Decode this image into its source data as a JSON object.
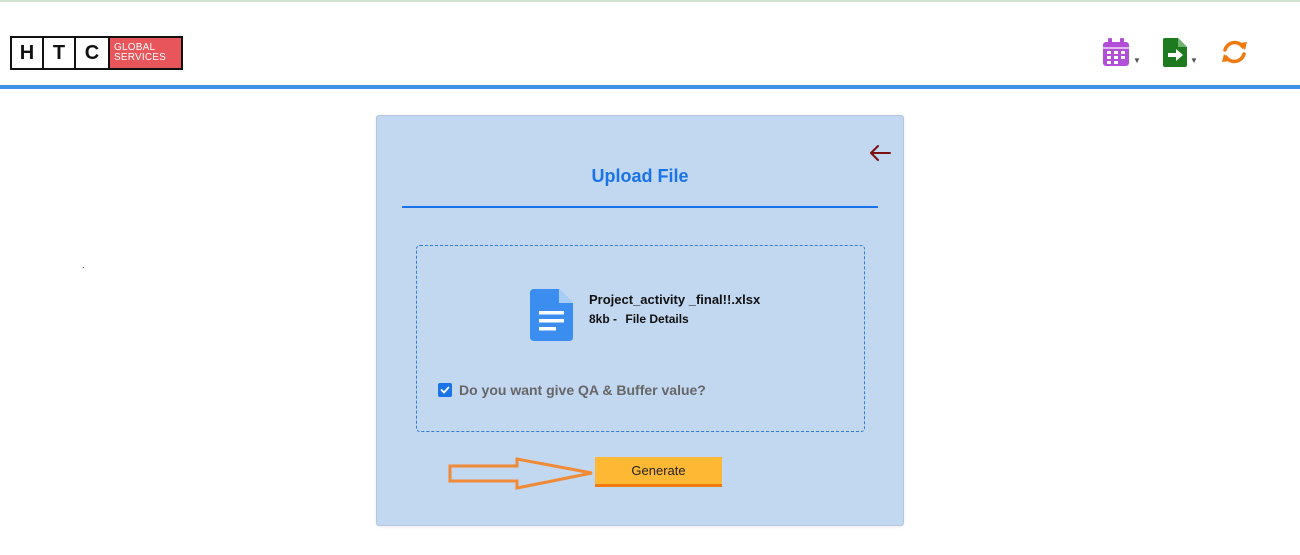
{
  "logo": {
    "letters": [
      "H",
      "T",
      "C"
    ],
    "tag_line1": "GLOBAL",
    "tag_line2": "SERVICES",
    "accent": "#e8555b"
  },
  "toolbar": {
    "icons": [
      {
        "name": "calendar-icon",
        "color": "#b14fd9",
        "has_dropdown": true
      },
      {
        "name": "file-export-icon",
        "color": "#1e7a1e",
        "has_dropdown": true
      },
      {
        "name": "refresh-icon",
        "color": "#f07a10",
        "has_dropdown": false
      }
    ]
  },
  "upload": {
    "title": "Upload File",
    "file_name": "Project_activity _final!!.xlsx",
    "file_size": "8kb -",
    "file_details": "File Details",
    "checkbox_label": "Do you want give QA & Buffer value?",
    "checkbox_checked": true,
    "generate_label": "Generate"
  },
  "colors": {
    "header_rule": "#3d8fe6",
    "card_bg": "#c2d7f0",
    "title": "#1a73e8",
    "button": "#ffb833",
    "arrow": "#f08a36"
  }
}
